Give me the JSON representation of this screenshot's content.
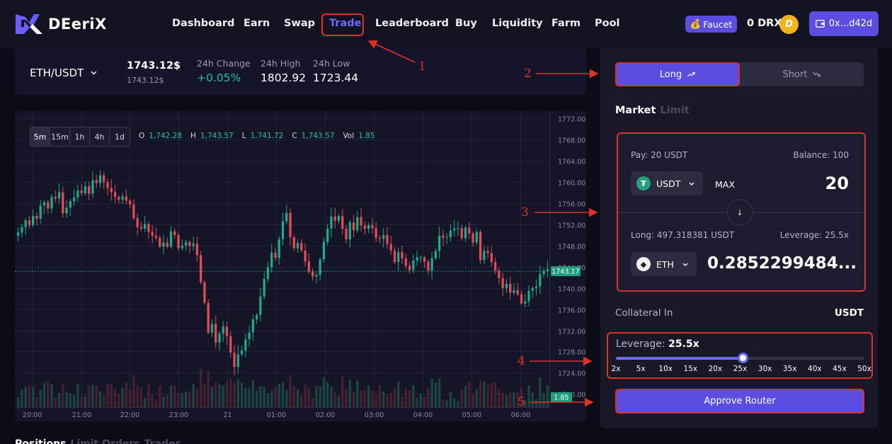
{
  "brand": {
    "name": "DEeriX"
  },
  "nav": {
    "items": [
      "Dashboard",
      "Earn",
      "Swap",
      "Trade",
      "Leaderboard",
      "Buy",
      "Liquidity",
      "Farm",
      "Pool"
    ],
    "active": "Trade"
  },
  "header": {
    "faucet_label": "Faucet",
    "drx_balance": "0 DRX",
    "drx_icon_letter": "D",
    "wallet_label": "0x...d42d"
  },
  "ticker": {
    "pair": "ETH/USDT",
    "price": "1743.12$",
    "price_sub": "1743.12$",
    "change_label": "24h Change",
    "change_value": "+0.05%",
    "high_label": "24h High",
    "high_value": "1802.92",
    "low_label": "24h Low",
    "low_value": "1723.44"
  },
  "chart": {
    "timeframes": [
      "5m",
      "15m",
      "1h",
      "4h",
      "1d"
    ],
    "active_timeframe": "5m",
    "ohlc": {
      "o_label": "O",
      "o": "1,742.28",
      "h_label": "H",
      "h": "1,743.57",
      "l_label": "L",
      "l": "1,741.72",
      "c_label": "C",
      "c": "1,743.57",
      "vol_label": "Vol",
      "vol": "1.85"
    },
    "last_price_label": "1743.17",
    "volume_label": "1.85",
    "colors": {
      "up": "#22a88a",
      "down": "#e04d57",
      "grid": "#22223a",
      "last_line": "#22c39a"
    }
  },
  "chart_data": {
    "type": "candlestick",
    "y_ticks": [
      "1772.00",
      "1768.00",
      "1764.00",
      "1760.00",
      "1756.00",
      "1752.00",
      "1748.00",
      "1744.00",
      "1740.00",
      "1736.00",
      "1732.00",
      "1728.00",
      "1724.00",
      "1720.00"
    ],
    "x_ticks": [
      "20:00",
      "21:00",
      "22:00",
      "23:00",
      "21",
      "01:00",
      "02:00",
      "03:00",
      "04:00",
      "05:00",
      "06:00"
    ],
    "ylim": [
      1717.5,
      1773.4
    ],
    "close": [
      1750.5,
      1751.5,
      1752.8,
      1751.9,
      1753.6,
      1753.1,
      1755.6,
      1756.2,
      1755.0,
      1757.2,
      1756.9,
      1758.1,
      1754.1,
      1755.2,
      1756.4,
      1757.1,
      1758.4,
      1757.9,
      1759.2,
      1757.8,
      1760.4,
      1759.8,
      1761.3,
      1760.0,
      1758.9,
      1758.1,
      1757.2,
      1756.7,
      1757.3,
      1756.5,
      1755.8,
      1753.2,
      1751.5,
      1751.2,
      1752.1,
      1750.6,
      1749.9,
      1749.5,
      1747.8,
      1748.6,
      1747.8,
      1750.7,
      1750.0,
      1747.5,
      1748.0,
      1748.7,
      1747.9,
      1748.4,
      1746.2,
      1741.1,
      1737.2,
      1731.6,
      1733.2,
      1729.7,
      1731.4,
      1732.7,
      1730.9,
      1727.8,
      1725.1,
      1727.5,
      1728.2,
      1730.3,
      1731.6,
      1734.1,
      1734.9,
      1738.4,
      1741.7,
      1743.9,
      1746.7,
      1745.7,
      1749.2,
      1752.6,
      1754.2,
      1749.6,
      1747.5,
      1748.5,
      1747.1,
      1745.0,
      1743.1,
      1742.2,
      1742.5,
      1745.4,
      1748.7,
      1751.2,
      1753.5,
      1752.7,
      1753.6,
      1751.2,
      1749.2,
      1752.4,
      1750.9,
      1753.4,
      1751.8,
      1751.2,
      1751.9,
      1751.3,
      1749.5,
      1749.3,
      1750.0,
      1748.3,
      1747.1,
      1744.9,
      1746.8,
      1745.6,
      1744.2,
      1743.4,
      1745.2,
      1745.8,
      1745.8,
      1745.0,
      1743.3,
      1745.6,
      1747.0,
      1749.9,
      1749.5,
      1749.6,
      1750.9,
      1751.2,
      1751.3,
      1749.4,
      1751.4,
      1750.3,
      1748.6,
      1750.6,
      1745.3,
      1747.0,
      1746.6,
      1744.9,
      1743.3,
      1741.9,
      1740.0,
      1740.8,
      1739.1,
      1739.6,
      1738.8,
      1737.1,
      1737.5,
      1739.5,
      1740.0,
      1740.3,
      1742.6,
      1743.2,
      1743.6
    ]
  },
  "trade": {
    "long_label": "Long",
    "short_label": "Short",
    "order_types": [
      "Market",
      "Limit"
    ],
    "active_order_type": "Market",
    "pay_label": "Pay: 20 USDT",
    "balance_label": "Balance: 100",
    "pay_token": "USDT",
    "max_label": "MAX",
    "pay_amount": "20",
    "long_amount_label": "Long: 497.318381 USDT",
    "leverage_info": "Leverage: 25.5x",
    "receive_token": "ETH",
    "receive_amount": "0.2852299484...",
    "collateral_label": "Collateral In",
    "collateral_value": "USDT",
    "leverage_title": "Leverage:",
    "leverage_value": "25.5x",
    "leverage_level": 25.5,
    "leverage_ticks": [
      "2x",
      "5x",
      "10x",
      "15x",
      "20x",
      "25x",
      "30x",
      "35x",
      "40x",
      "45x",
      "50x"
    ],
    "approve_label": "Approve Router"
  },
  "bottom_tabs": [
    "Positions",
    "Limit Orders",
    "Trades"
  ],
  "annotations": [
    "1",
    "2",
    "3",
    "4",
    "5"
  ]
}
